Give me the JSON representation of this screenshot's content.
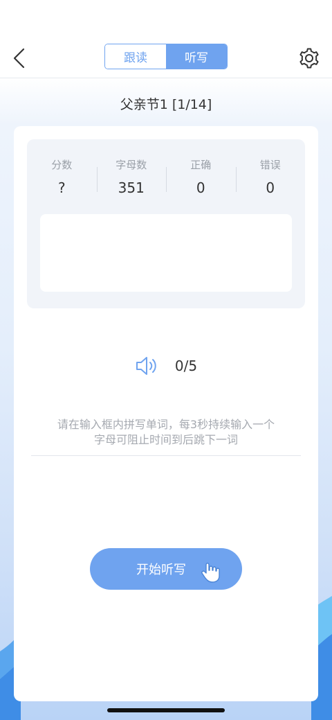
{
  "nav": {
    "tabs": [
      {
        "label": "跟读",
        "active": false
      },
      {
        "label": "听写",
        "active": true
      }
    ]
  },
  "lesson": {
    "title": "父亲节1 [1/14]"
  },
  "stats": [
    {
      "label": "分数",
      "value": "?"
    },
    {
      "label": "字母数",
      "value": "351"
    },
    {
      "label": "正确",
      "value": "0"
    },
    {
      "label": "错误",
      "value": "0"
    }
  ],
  "audio": {
    "icon": "speaker-icon",
    "progress": "0/5"
  },
  "hint": {
    "line1": "请在输入框内拼写单词，每3秒持续输入一个",
    "line2": "字母可阻止时间到后跳下一词"
  },
  "start_button": {
    "label": "开始听写",
    "icon": "tap-hand-icon"
  },
  "colors": {
    "accent": "#6fa3ef",
    "panel": "#f1f4f9",
    "text": "#333333",
    "muted": "#9aa0a8"
  }
}
